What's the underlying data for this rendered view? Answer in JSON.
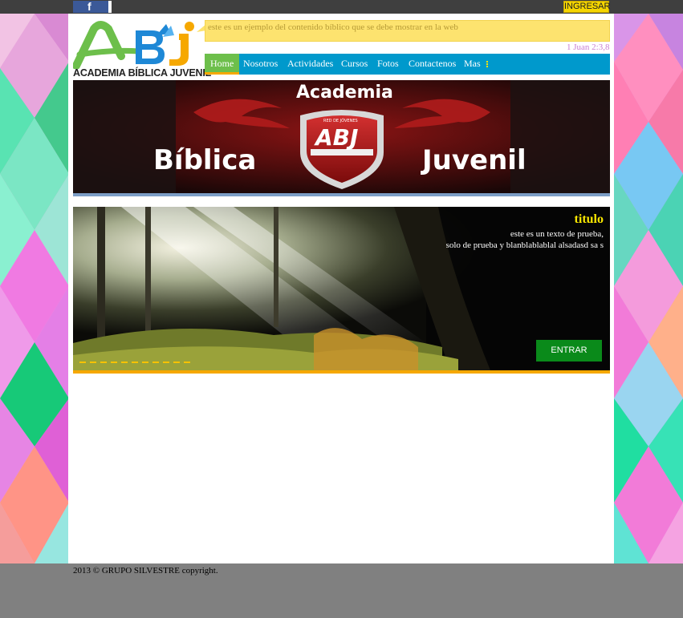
{
  "topbar": {
    "facebook_icon": "facebook-icon",
    "login_label": "INGRESAR"
  },
  "logo": {
    "mark": "ABJ",
    "caption": "ACADEMIA BÍBLICA JUVENIL",
    "colors": {
      "green": "#6dbf4b",
      "blue": "#1e88d6",
      "orange": "#f6a800"
    }
  },
  "verse": {
    "text": "este es un ejemplo del contenido bíblico que se debe mostrar en la web",
    "reference": "1 Juan 2:3,8"
  },
  "nav": {
    "items": [
      {
        "label": "Home",
        "active": true
      },
      {
        "label": "Nosotros",
        "active": false
      },
      {
        "label": "Actividades",
        "active": false
      },
      {
        "label": "Cursos",
        "active": false
      },
      {
        "label": "Fotos",
        "active": false
      },
      {
        "label": "Contactenos",
        "active": false
      },
      {
        "label": "Mas",
        "active": false,
        "icon": "more-dots-icon"
      }
    ],
    "colors": {
      "bar": "#0099cc",
      "active": "#6dbf4b",
      "underline": "#f6a800"
    }
  },
  "banner": {
    "word_top": "Academia",
    "word_left": "Bíblica",
    "word_right": "Juvenil",
    "shield_text": "ABJ",
    "shield_subtitle": "RED DE JÓVENES"
  },
  "slider": {
    "title": "titulo",
    "lines": [
      "este es un texto de prueba,",
      "solo de prueba y blanblablablal alsadasd sa s"
    ],
    "button_label": "ENTRAR",
    "image": "forest-sunbeams-image"
  },
  "footer": {
    "text": "2013 © GRUPO SILVESTRE copyright."
  }
}
